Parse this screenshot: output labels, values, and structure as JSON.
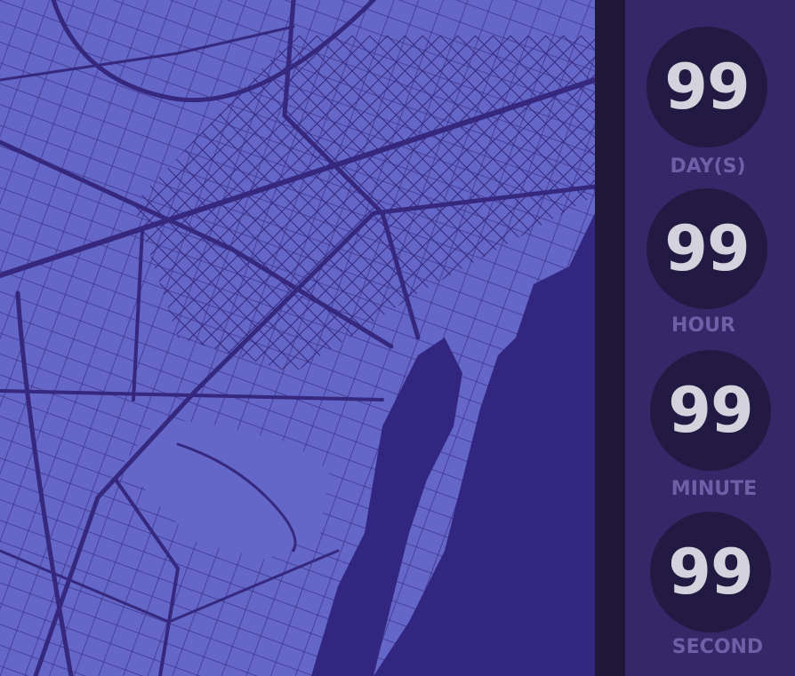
{
  "colors": {
    "map_land": "#6466c8",
    "map_roads": "#35287e",
    "sea": "#322680",
    "panel": "#352768",
    "circle": "#221a42",
    "number": "#d4d2dc",
    "label": "#6e5fa8"
  },
  "countdown": [
    {
      "value": "99",
      "label": "DAY(S)"
    },
    {
      "value": "99",
      "label": "HOUR"
    },
    {
      "value": "99",
      "label": "MINUTE"
    },
    {
      "value": "99",
      "label": "SECOND"
    }
  ]
}
